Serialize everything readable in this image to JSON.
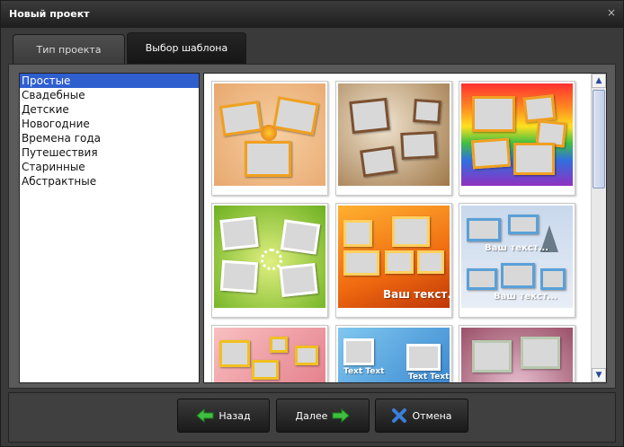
{
  "window": {
    "title": "Новый проект",
    "close_glyph": "×"
  },
  "tabs": [
    {
      "label": "Тип проекта",
      "active": false
    },
    {
      "label": "Выбор шаблона",
      "active": true
    }
  ],
  "categories": {
    "items": [
      "Простые",
      "Свадебные",
      "Детские",
      "Новогодние",
      "Времена года",
      "Путешествия",
      "Старинные",
      "Абстрактные"
    ],
    "selected": "Простые"
  },
  "templates": {
    "visible_overlay_texts": {
      "orange_template": "Ваш текст...",
      "winter_template_top": "Ваш текст...",
      "winter_template_bottom": "Ваш текст...",
      "blue_template_left": "Text Text",
      "blue_template_right": "Text Text"
    }
  },
  "footer": {
    "back_label": "Назад",
    "next_label": "Далее",
    "cancel_label": "Отмена"
  },
  "colors": {
    "selection": "#2f5fcf",
    "arrow_green": "#3fbf3f",
    "cancel_blue": "#3a7fd8"
  },
  "icons": {
    "back": "left-arrow-icon",
    "next": "right-arrow-icon",
    "cancel": "x-icon"
  }
}
